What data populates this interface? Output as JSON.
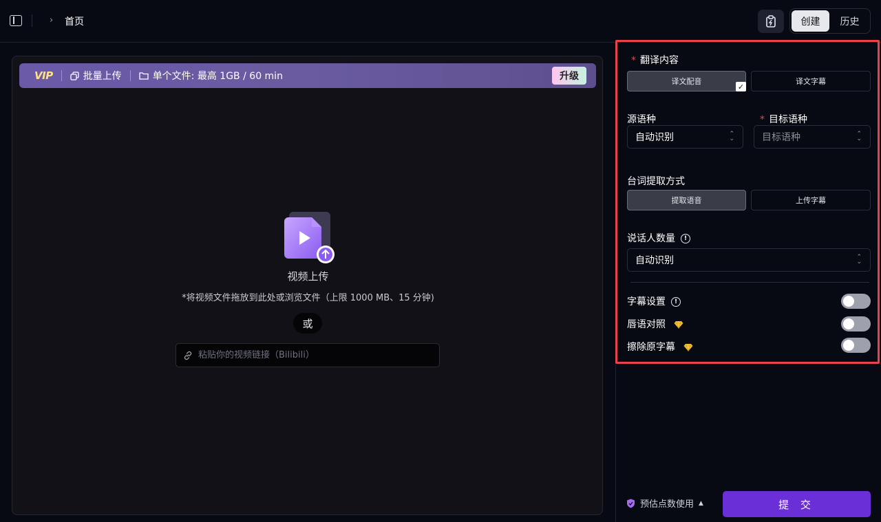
{
  "header": {
    "breadcrumb": "首页",
    "tabs": [
      {
        "label": "创建",
        "active": true
      },
      {
        "label": "历史",
        "active": false
      }
    ]
  },
  "upload": {
    "vip_label": "VIP",
    "batch_upload": "批量上传",
    "single_file_limit": "单个文件: 最高 1GB / 60 min",
    "upgrade": "升级",
    "title": "视频上传",
    "hint": "*将视频文件拖放到此处或浏览文件（上限 1000 MB、15 分钟)",
    "or": "或",
    "link_placeholder": "粘贴你的视频链接（Bilibili）"
  },
  "settings": {
    "translate_content_label": "翻译内容",
    "translate_options": [
      "译文配音",
      "译文字幕"
    ],
    "source_lang_label": "源语种",
    "source_lang_value": "自动识别",
    "target_lang_label": "目标语种",
    "target_lang_placeholder": "目标语种",
    "extract_label": "台词提取方式",
    "extract_options": [
      "提取语音",
      "上传字幕"
    ],
    "speaker_count_label": "说话人数量",
    "speaker_count_value": "自动识别",
    "subtitle_settings": "字幕设置",
    "lip_sync": "唇语对照",
    "erase_subtitles": "擦除原字幕"
  },
  "footer": {
    "estimate": "预估点数使用",
    "submit": "提 交"
  },
  "colors": {
    "accent": "#6b2fd8",
    "highlight_border": "#e8424a",
    "required_mark": "#e8424a"
  }
}
